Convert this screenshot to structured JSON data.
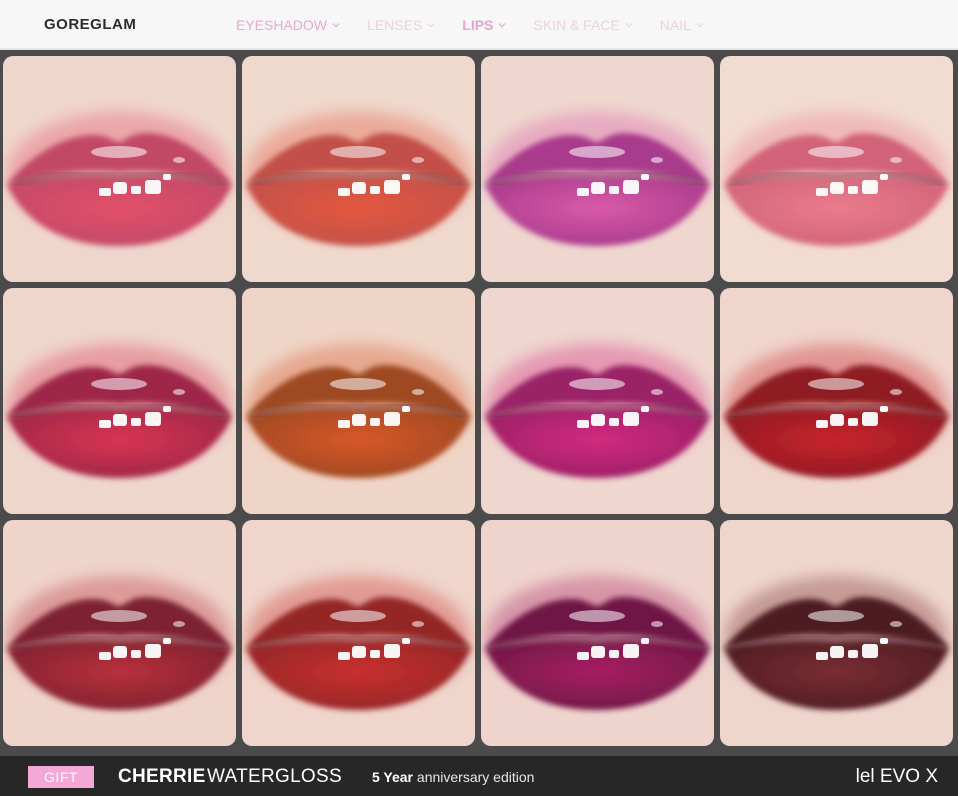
{
  "brand": "GOREGLAM",
  "nav": {
    "items": [
      {
        "label": "EYESHADOW",
        "name": "eyeshadow"
      },
      {
        "label": "LENSES",
        "name": "lenses"
      },
      {
        "label": "LIPS",
        "name": "lips"
      },
      {
        "label": "SKIN & FACE",
        "name": "skin-face"
      },
      {
        "label": "NAIL",
        "name": "nail"
      }
    ]
  },
  "swatches": [
    {
      "lip": "#e3506a",
      "upper": "#c24a66",
      "skin": "#efd6cc"
    },
    {
      "lip": "#e3573f",
      "upper": "#c2504a",
      "skin": "#efd8cc"
    },
    {
      "lip": "#d95aa8",
      "upper": "#a93b8c",
      "skin": "#efd7cf"
    },
    {
      "lip": "#ea7b8d",
      "upper": "#d26478",
      "skin": "#f2dcd2"
    },
    {
      "lip": "#d93452",
      "upper": "#9e2848",
      "skin": "#efd6cd"
    },
    {
      "lip": "#d8562a",
      "upper": "#9e4a22",
      "skin": "#efd5c7"
    },
    {
      "lip": "#d32a7f",
      "upper": "#9a2166",
      "skin": "#efd6cf"
    },
    {
      "lip": "#c9242c",
      "upper": "#8e1a24",
      "skin": "#efd5cc"
    },
    {
      "lip": "#b9303c",
      "upper": "#7e2230",
      "skin": "#efd4cb"
    },
    {
      "lip": "#c9302e",
      "upper": "#942628",
      "skin": "#efd5cb"
    },
    {
      "lip": "#a82063",
      "upper": "#6f1746",
      "skin": "#efd4cd"
    },
    {
      "lip": "#7a2e33",
      "upper": "#4e1c22",
      "skin": "#efd6cd"
    }
  ],
  "footer": {
    "gift_label": "GIFT",
    "product_name": "CHERRIE",
    "product_type": "WATERGLOSS",
    "edition_bold": "5 Year",
    "edition_rest": " anniversary edition",
    "platform": "lel EVO X"
  }
}
